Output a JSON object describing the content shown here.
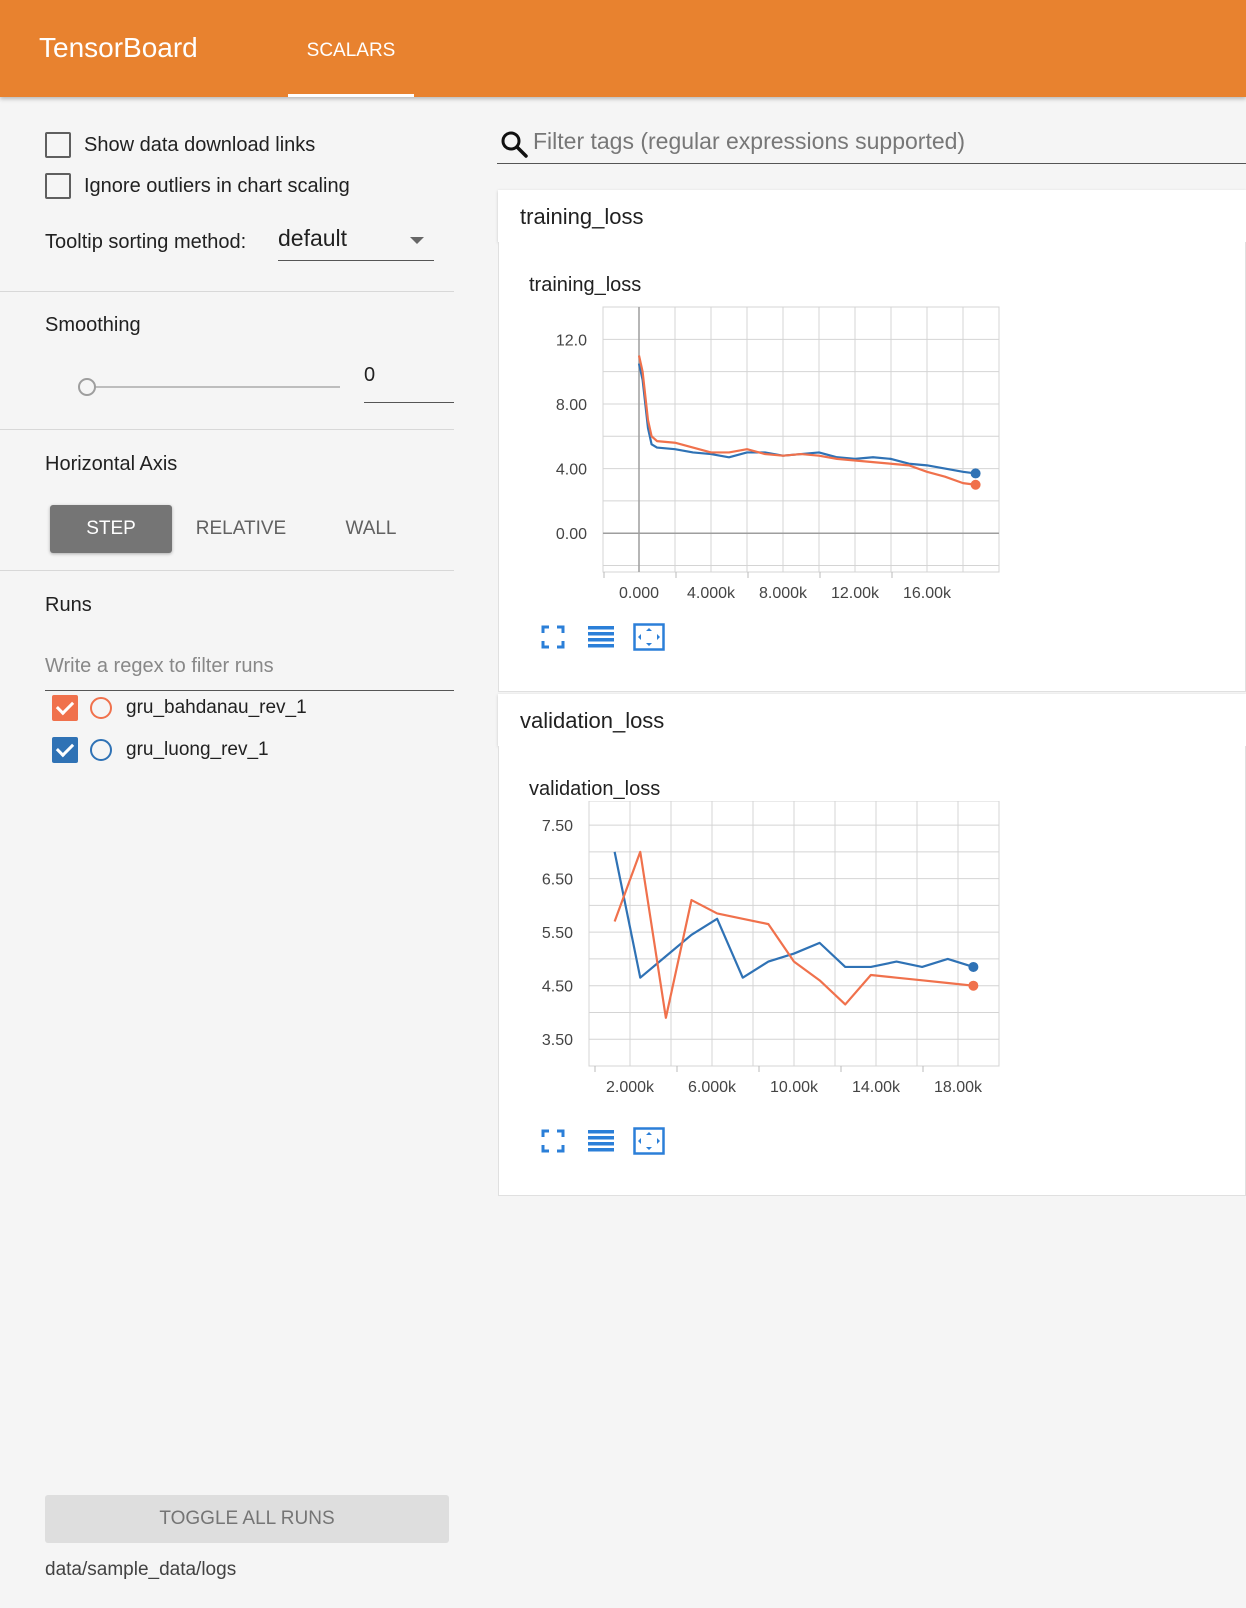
{
  "header": {
    "brand": "TensorBoard",
    "tabs": [
      {
        "label": "SCALARS",
        "active": true
      }
    ],
    "background": "#e8822f"
  },
  "sidebar": {
    "show_download_links": {
      "label": "Show data download links",
      "checked": false
    },
    "ignore_outliers": {
      "label": "Ignore outliers in chart scaling",
      "checked": false
    },
    "tooltip_sorting": {
      "label": "Tooltip sorting method:",
      "value": "default"
    },
    "smoothing": {
      "title": "Smoothing",
      "value": "0",
      "fraction": 0
    },
    "horizontal_axis": {
      "title": "Horizontal Axis",
      "options": [
        "STEP",
        "RELATIVE",
        "WALL"
      ],
      "selected": "STEP"
    },
    "runs": {
      "title": "Runs",
      "filter_placeholder": "Write a regex to filter runs",
      "items": [
        {
          "name": "gru_bahdanau_rev_1",
          "checked": true,
          "color": "#f0714c"
        },
        {
          "name": "gru_luong_rev_1",
          "checked": true,
          "color": "#2f72b5"
        }
      ]
    },
    "toggle_all_label": "TOGGLE ALL RUNS",
    "logdir": "data/sample_data/logs"
  },
  "main": {
    "search_placeholder": "Filter tags (regular expressions supported)",
    "cards": [
      {
        "title": "training_loss",
        "chart_title": "training_loss"
      },
      {
        "title": "validation_loss",
        "chart_title": "validation_loss"
      }
    ]
  },
  "chart_data": [
    {
      "type": "line",
      "title": "training_loss",
      "xlim": [
        -2000,
        20000
      ],
      "ylim": [
        -2.4,
        14
      ],
      "x_ticks": [
        0,
        4000,
        8000,
        12000,
        16000
      ],
      "x_tick_labels": [
        "0.000",
        "4.000k",
        "8.000k",
        "12.00k",
        "16.00k"
      ],
      "y_ticks": [
        0,
        4,
        8,
        12
      ],
      "y_tick_labels": [
        "0.00",
        "4.00",
        "8.00",
        "12.0"
      ],
      "series": [
        {
          "name": "gru_luong_rev_1",
          "color": "#2f72b5",
          "x": [
            0,
            200,
            500,
            700,
            1000,
            2000,
            3000,
            4000,
            5000,
            6000,
            7000,
            8000,
            9000,
            10000,
            11000,
            12000,
            13000,
            14000,
            15000,
            16000,
            17000,
            18000,
            18700
          ],
          "y": [
            10.5,
            9.5,
            6.5,
            5.5,
            5.3,
            5.2,
            5.0,
            4.9,
            4.7,
            5.0,
            5.0,
            4.8,
            4.9,
            5.0,
            4.7,
            4.6,
            4.7,
            4.6,
            4.3,
            4.2,
            4.0,
            3.8,
            3.7
          ]
        },
        {
          "name": "gru_bahdanau_rev_1",
          "color": "#f0714c",
          "x": [
            0,
            200,
            500,
            700,
            1000,
            2000,
            3000,
            4000,
            5000,
            6000,
            7000,
            8000,
            9000,
            10000,
            11000,
            12000,
            13000,
            14000,
            15000,
            16000,
            17000,
            18000,
            18700
          ],
          "y": [
            11.0,
            10.0,
            7.0,
            6.0,
            5.7,
            5.6,
            5.3,
            5.0,
            5.0,
            5.2,
            4.9,
            4.8,
            4.9,
            4.8,
            4.6,
            4.5,
            4.4,
            4.3,
            4.2,
            3.8,
            3.5,
            3.1,
            3.0
          ]
        }
      ]
    },
    {
      "type": "line",
      "title": "validation_loss",
      "xlim": [
        0,
        20000
      ],
      "ylim": [
        3.0,
        7.95
      ],
      "x_ticks": [
        2000,
        6000,
        10000,
        14000,
        18000
      ],
      "x_tick_labels": [
        "2.000k",
        "6.000k",
        "10.00k",
        "14.00k",
        "18.00k"
      ],
      "y_ticks": [
        3.5,
        4.5,
        5.5,
        6.5,
        7.5
      ],
      "y_tick_labels": [
        "3.50",
        "4.50",
        "5.50",
        "6.50",
        "7.50"
      ],
      "series": [
        {
          "name": "gru_luong_rev_1",
          "color": "#2f72b5",
          "x": [
            1250,
            2500,
            3750,
            5000,
            6250,
            7500,
            8750,
            10000,
            11250,
            12500,
            13750,
            15000,
            16250,
            17500,
            18750
          ],
          "y": [
            7.0,
            4.65,
            5.05,
            5.45,
            5.75,
            4.65,
            4.95,
            5.1,
            5.3,
            4.85,
            4.85,
            4.95,
            4.85,
            5.0,
            4.85
          ]
        },
        {
          "name": "gru_bahdanau_rev_1",
          "color": "#f0714c",
          "x": [
            1250,
            2500,
            3750,
            5000,
            6250,
            7500,
            8750,
            10000,
            11250,
            12500,
            13750,
            15000,
            16250,
            17500,
            18750
          ],
          "y": [
            5.7,
            7.0,
            3.9,
            6.1,
            5.85,
            5.75,
            5.65,
            4.95,
            4.6,
            4.15,
            4.7,
            4.65,
            4.6,
            4.55,
            4.5
          ]
        }
      ]
    }
  ]
}
